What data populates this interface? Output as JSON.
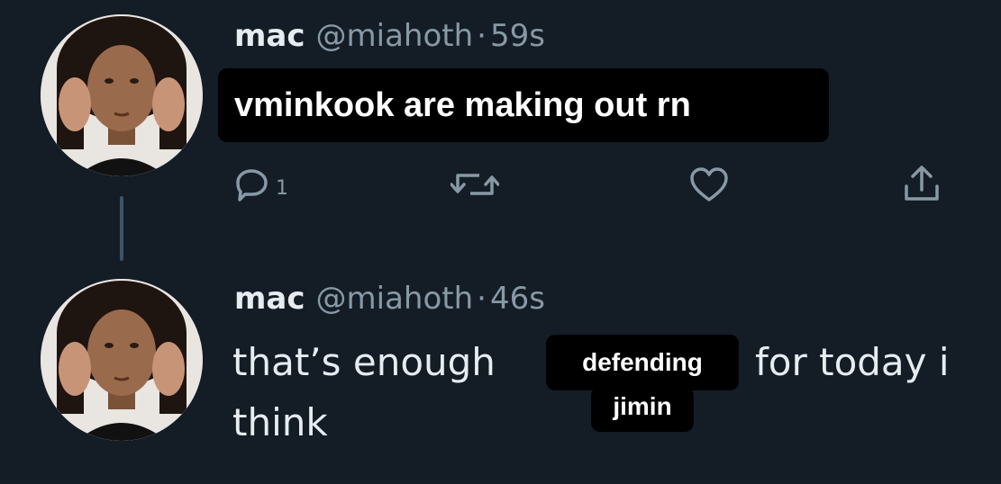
{
  "colors": {
    "background": "#141d26",
    "primary_text": "#e6ecf0",
    "secondary_text": "#8899a6",
    "sticker_background": "#000000",
    "sticker_text": "#ffffff"
  },
  "tweets": [
    {
      "display_name": "mac",
      "handle": "@miahoth",
      "separator": "·",
      "time": "59s",
      "text_sticker": "vminkook are making out rn",
      "actions": {
        "reply_icon": "reply-icon",
        "reply_count": "1",
        "retweet_icon": "retweet-icon",
        "like_icon": "heart-icon",
        "share_icon": "share-icon"
      }
    },
    {
      "display_name": "mac",
      "handle": "@miahoth",
      "separator": "·",
      "time": "46s",
      "text_start": "that’s enough",
      "sticker_line1": "defending",
      "sticker_line2": "jimin",
      "text_end": "for today i",
      "text_line2": "think"
    }
  ]
}
